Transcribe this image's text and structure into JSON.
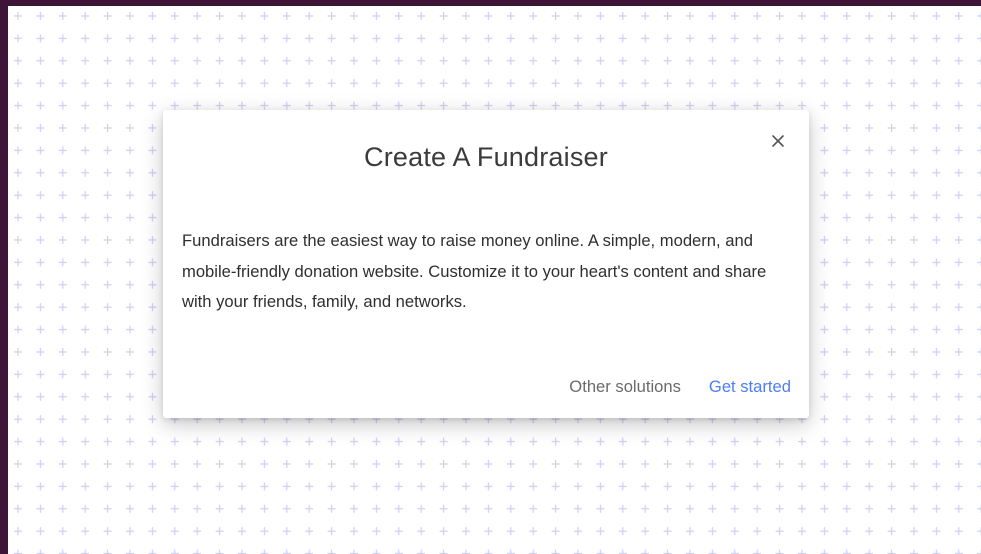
{
  "dialog": {
    "title": "Create A Fundraiser",
    "body": "Fundraisers are the easiest way to raise money online. A simple, modern, and mobile-friendly donation website. Customize it to your heart's content and share with your friends, family, and networks.",
    "close_icon": "close-icon",
    "actions": {
      "secondary_label": "Other solutions",
      "primary_label": "Get started"
    }
  },
  "colors": {
    "frame": "#3e1538",
    "pattern": "#d2d0f4",
    "primary_action": "#4d7ef7",
    "secondary_action": "#6b6b6b"
  }
}
